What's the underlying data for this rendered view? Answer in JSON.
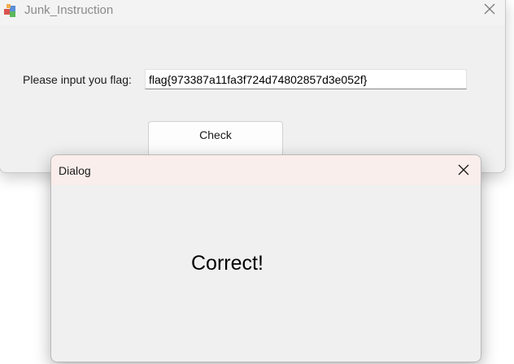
{
  "main_window": {
    "title": "Junk_Instruction",
    "app_icon": "app-cube-icon",
    "close_icon": "close-icon",
    "flag_label": "Please input you flag:",
    "flag_value": "flag{973387a11fa3f724d74802857d3e052f}",
    "check_button_label": "Check"
  },
  "dialog": {
    "title": "Dialog",
    "close_icon": "close-icon",
    "message": "Correct!"
  },
  "colors": {
    "window_bg": "#f0f0f0",
    "dialog_titlebar_bg": "#f9eeeb",
    "input_bg": "#ffffff"
  }
}
